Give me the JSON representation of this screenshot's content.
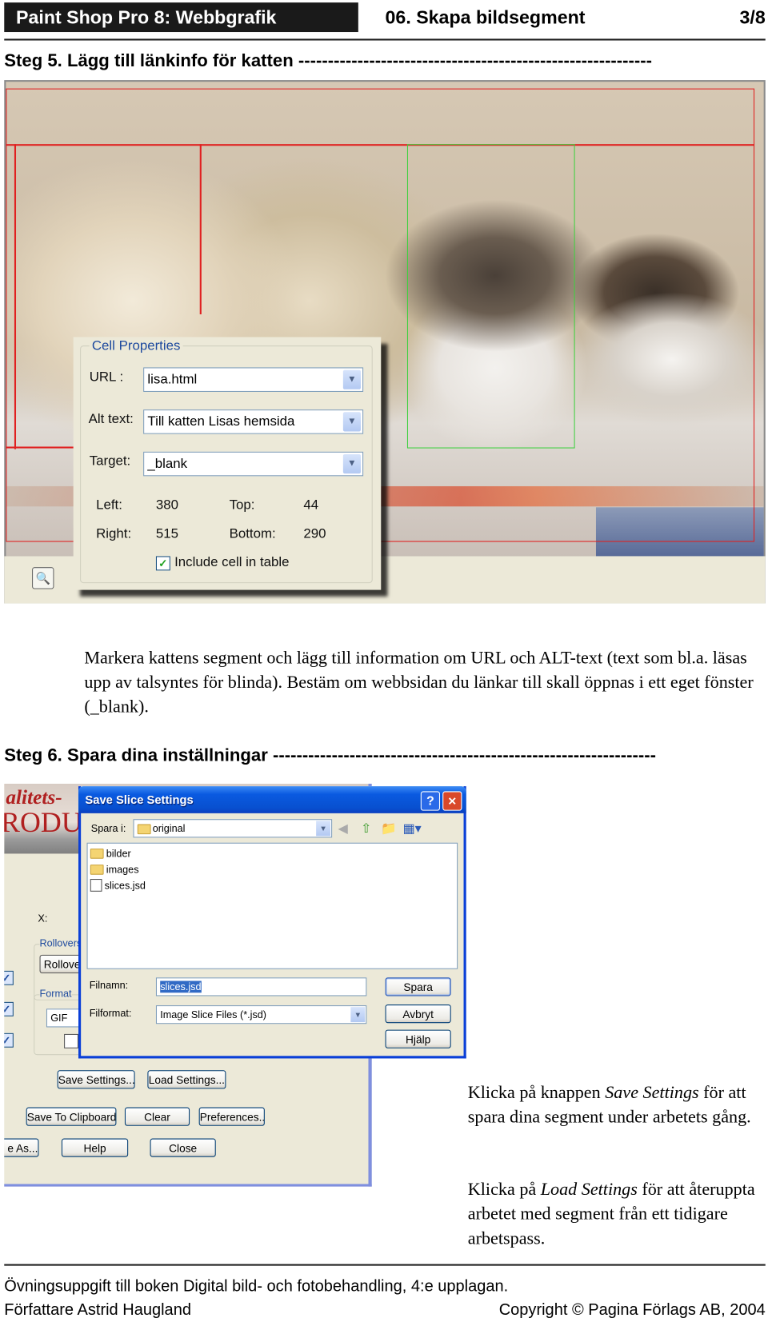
{
  "header": {
    "course": "Paint Shop Pro 8: Webbgrafik",
    "chapter": "06. Skapa bildsegment",
    "page": "3/8"
  },
  "step5": {
    "heading": "Steg 5. Lägg till länkinfo för katten",
    "dashes": "------------------------------------------------------------",
    "cell_properties": {
      "legend": "Cell Properties",
      "url_label": "URL :",
      "url_value": "lisa.html",
      "alt_label": "Alt text:",
      "alt_value": "Till katten Lisas hemsida",
      "target_label": "Target:",
      "target_value": "_blank",
      "left_label": "Left:",
      "left_value": "380",
      "top_label": "Top:",
      "top_value": "44",
      "right_label": "Right:",
      "right_value": "515",
      "bottom_label": "Bottom:",
      "bottom_value": "290",
      "include_label": "Include cell in table",
      "include_checked": true
    },
    "slice_colors": {
      "slice": "#e02020",
      "selected": "#40d040"
    },
    "paragraph": "Markera kattens segment och lägg till information om URL och ALT-text (text som bl.a. läsas upp av talsyntes för blinda). Bestäm om webbsidan du länkar till skall öppnas i ett eget fönster (_blank)."
  },
  "step6": {
    "heading": "Steg 6. Spara dina inställningar",
    "dashes": "-----------------------------------------------------------------",
    "background_panel": {
      "photo_text_1": "alitets-",
      "photo_text_2": "RODU",
      "x_label": "X:",
      "rollovers_legend": "Rollovers",
      "rollover_button": "Rollover",
      "format_legend": "Format",
      "format_value": "GIF",
      "buttons": {
        "save_settings": "Save Settings...",
        "load_settings": "Load Settings...",
        "save_clipboard": "Save To Clipboard...",
        "clear": "Clear",
        "preferences": "Preferences...",
        "save_as": "e As...",
        "help": "Help",
        "close": "Close"
      }
    },
    "save_dialog": {
      "title": "Save Slice Settings",
      "help_glyph": "?",
      "close_glyph": "✕",
      "save_in_label": "Spara i:",
      "save_in_value": "original",
      "files": [
        {
          "name": "bilder",
          "icon": "folder-icon"
        },
        {
          "name": "images",
          "icon": "folder-icon"
        },
        {
          "name": "slices.jsd",
          "icon": "file-icon"
        }
      ],
      "filename_label": "Filnamn:",
      "filename_value": "slices.jsd",
      "filetype_label": "Filformat:",
      "filetype_value": "Image Slice Files (*.jsd)",
      "save_button": "Spara",
      "cancel_button": "Avbryt",
      "help_button": "Hjälp"
    },
    "para1": {
      "pre": "Klicka på knappen ",
      "em": "Save Settings",
      "post": " för att spara dina segment under arbetets gång."
    },
    "para2": {
      "pre": "Klicka på ",
      "em": "Load Settings",
      "post": " för att återuppta arbetet med segment från ett tidigare arbetspass."
    }
  },
  "footer": {
    "line1": "Övningsuppgift till boken Digital bild- och fotobehandling, 4:e upplagan.",
    "author": "Författare Astrid Haugland",
    "copyright": "Copyright © Pagina Förlags AB, 2004"
  }
}
